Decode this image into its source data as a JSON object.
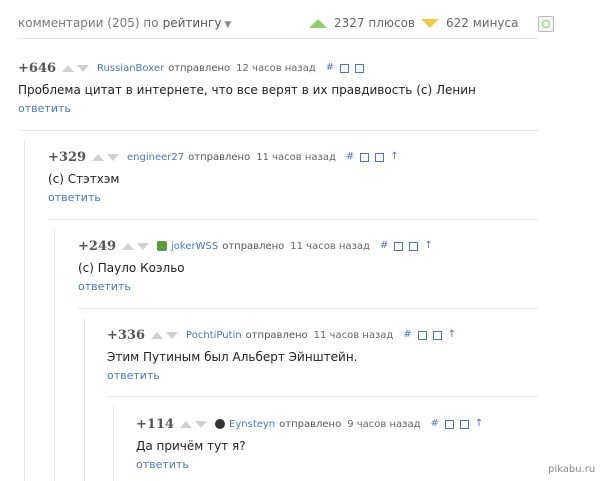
{
  "header": {
    "comments_label": "комментарии (205) по",
    "sort_label": "рейтингу",
    "plus_count": "2327 плюсов",
    "minus_count": "622 минуса"
  },
  "colors": {
    "link": "#4a78b8",
    "plus": "#8fcf6b",
    "minus": "#f0c94f"
  },
  "comments": [
    {
      "score": "+646",
      "author": "RussianBoxer",
      "sent": "отправлено",
      "time": "12 часов назад",
      "text": "Проблема цитат в интернете, что все верят в их правдивость (с) Ленин",
      "reply": "ответить",
      "hash": "#",
      "arrow": ""
    },
    {
      "score": "+329",
      "author": "engineer27",
      "sent": "отправлено",
      "time": "11 часов назад",
      "text": "(с) Стэтхэм",
      "reply": "ответить",
      "hash": "#",
      "arrow": "↑"
    },
    {
      "score": "+249",
      "author": "jokerWSS",
      "sent": "отправлено",
      "time": "11 часов назад",
      "text": "(с) Пауло Коэльо",
      "reply": "ответить",
      "hash": "#",
      "arrow": "↑"
    },
    {
      "score": "+336",
      "author": "PochtiPutin",
      "sent": "отправлено",
      "time": "11 часов назад",
      "text": "Этим Путиным был Альберт Эйнштейн.",
      "reply": "ответить",
      "hash": "#",
      "arrow": "↑"
    },
    {
      "score": "+114",
      "author": "Eynsteyn",
      "sent": "отправлено",
      "time": "9 часов назад",
      "text": "Да причём тут я?",
      "reply": "ответить",
      "hash": "#",
      "arrow": "↑"
    }
  ],
  "watermark": "pikabu.ru"
}
